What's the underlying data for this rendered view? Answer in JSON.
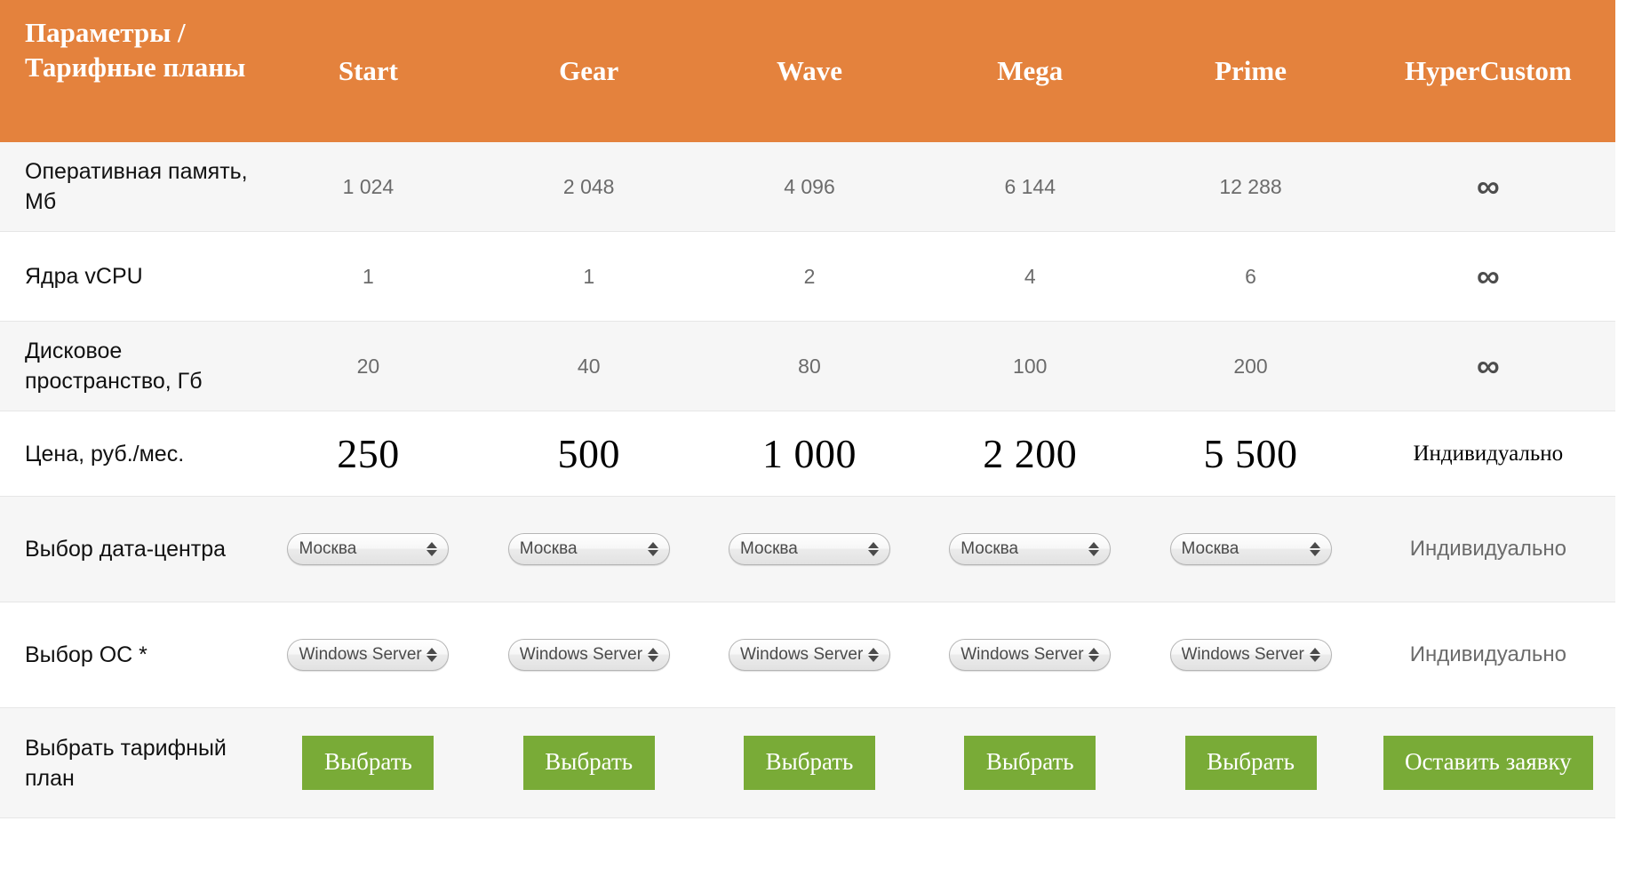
{
  "colors": {
    "header_bg": "#e4823d",
    "header_text": "#ffffff",
    "row_alt_bg": "#f6f6f6",
    "row_bg": "#ffffff",
    "button_green": "#79ab37",
    "value_gray": "#6b6b6b",
    "label_black": "#111111",
    "border": "#e6e6e6"
  },
  "table": {
    "header": {
      "param_label": "Параметры / Тарифные планы",
      "plans": [
        "Start",
        "Gear",
        "Wave",
        "Mega",
        "Prime",
        "HyperCustom"
      ]
    },
    "rows": [
      {
        "id": "ram",
        "label": "Оперативная память, Мб",
        "values": [
          "1 024",
          "2 048",
          "4 096",
          "6 144",
          "12 288"
        ],
        "custom": "∞",
        "custom_icon": "infinity-icon"
      },
      {
        "id": "vcpu",
        "label": "Ядра vCPU",
        "values": [
          "1",
          "1",
          "2",
          "4",
          "6"
        ],
        "custom": "∞",
        "custom_icon": "infinity-icon"
      },
      {
        "id": "disk",
        "label": "Дисковое пространство, Гб",
        "values": [
          "20",
          "40",
          "80",
          "100",
          "200"
        ],
        "custom": "∞",
        "custom_icon": "infinity-icon"
      },
      {
        "id": "price",
        "label": "Цена, руб./мес.",
        "values": [
          "250",
          "500",
          "1 000",
          "2 200",
          "5 500"
        ],
        "custom": "Индивидуально"
      },
      {
        "id": "datacenter",
        "label": "Выбор дата-центра",
        "select_value": "Москва",
        "custom": "Индивидуально"
      },
      {
        "id": "os",
        "label": "Выбор ОС *",
        "select_value": "Windows Server",
        "custom": "Индивидуально"
      },
      {
        "id": "choose-plan",
        "label": "Выбрать тарифный план",
        "button_label": "Выбрать",
        "custom_button_label": "Оставить заявку"
      }
    ]
  }
}
